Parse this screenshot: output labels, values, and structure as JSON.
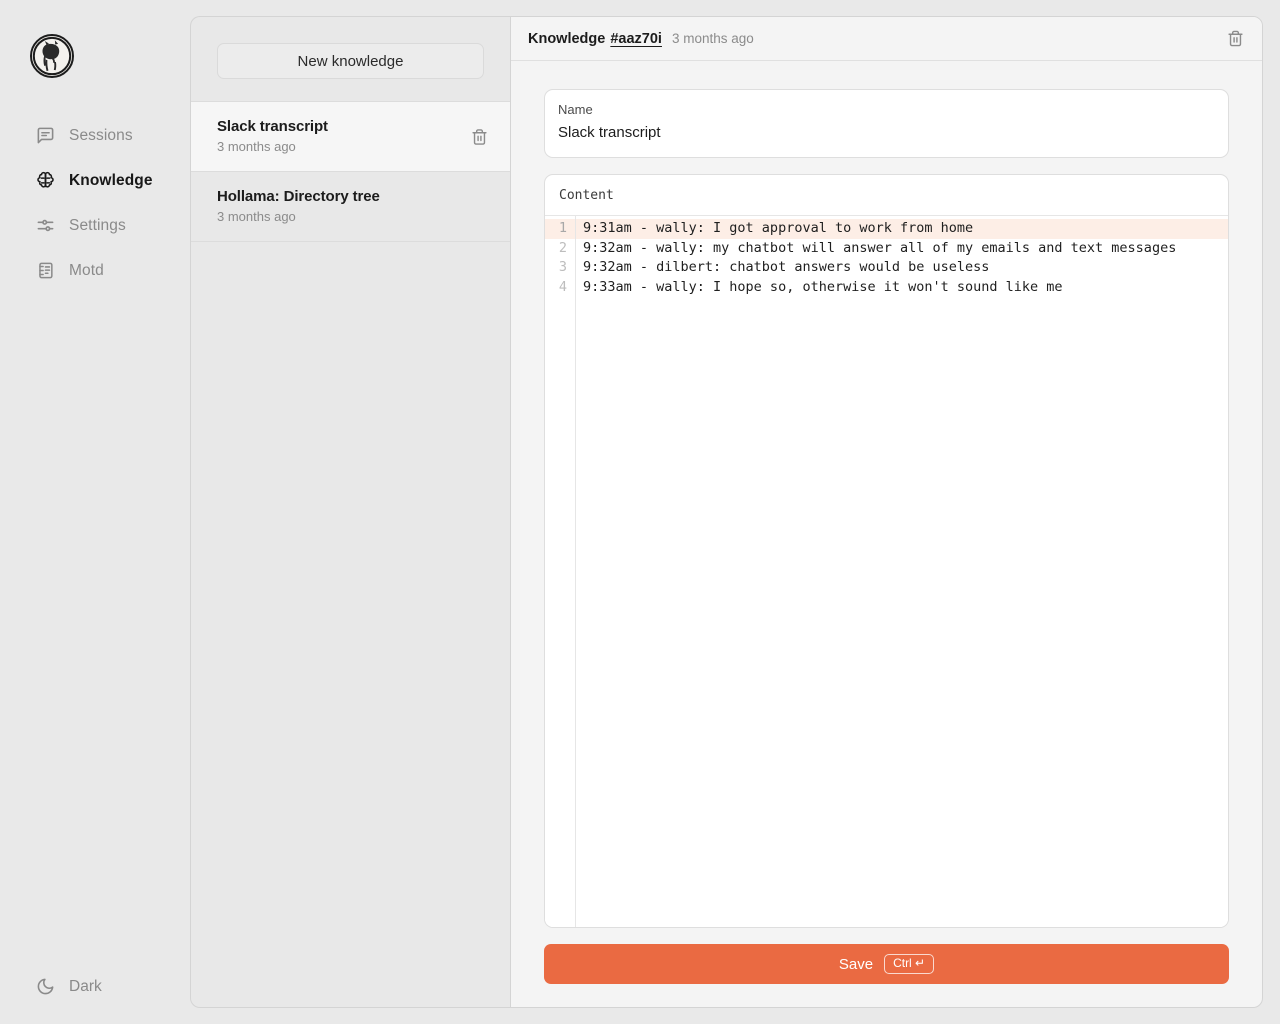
{
  "nav": {
    "logo_alt": "hollama-llama-logo",
    "items": [
      {
        "label": "Sessions",
        "icon": "message-square-icon",
        "active": false
      },
      {
        "label": "Knowledge",
        "icon": "brain-icon",
        "active": true
      },
      {
        "label": "Settings",
        "icon": "sliders-icon",
        "active": false
      },
      {
        "label": "Motd",
        "icon": "notebook-icon",
        "active": false
      }
    ],
    "theme_toggle": {
      "label": "Dark",
      "icon": "moon-icon"
    }
  },
  "list_panel": {
    "new_button_label": "New knowledge",
    "items": [
      {
        "name": "Slack transcript",
        "date": "3 months ago",
        "selected": true,
        "delete_icon": "trash-icon"
      },
      {
        "name": "Hollama: Directory tree",
        "date": "3 months ago",
        "selected": false,
        "delete_icon": ""
      }
    ]
  },
  "main": {
    "header": {
      "title": "Knowledge",
      "id": "#aaz70i",
      "date": "3 months ago",
      "delete_icon": "trash-icon"
    },
    "name_field": {
      "label": "Name",
      "value": "Slack transcript",
      "placeholder": ""
    },
    "content_field": {
      "label": "Content",
      "lines": [
        {
          "number": "1",
          "text": "9:31am - wally: I got approval to work from home",
          "active": true
        },
        {
          "number": "2",
          "text": "9:32am - wally: my chatbot will answer all of my emails and text messages",
          "active": false
        },
        {
          "number": "3",
          "text": "9:32am - dilbert: chatbot answers would be useless",
          "active": false
        },
        {
          "number": "4",
          "text": "9:33am - wally: I hope so, otherwise it won't sound like me",
          "active": false
        }
      ]
    },
    "save": {
      "label": "Save",
      "shortcut": "Ctrl ↵"
    }
  },
  "colors": {
    "accent": "#ea6a42",
    "page_bg": "#e9e9e9",
    "list_bg": "#e8e8e8",
    "main_bg": "#f4f4f4",
    "active_line": "#fdeee6",
    "muted_text": "#8b8b8b"
  }
}
